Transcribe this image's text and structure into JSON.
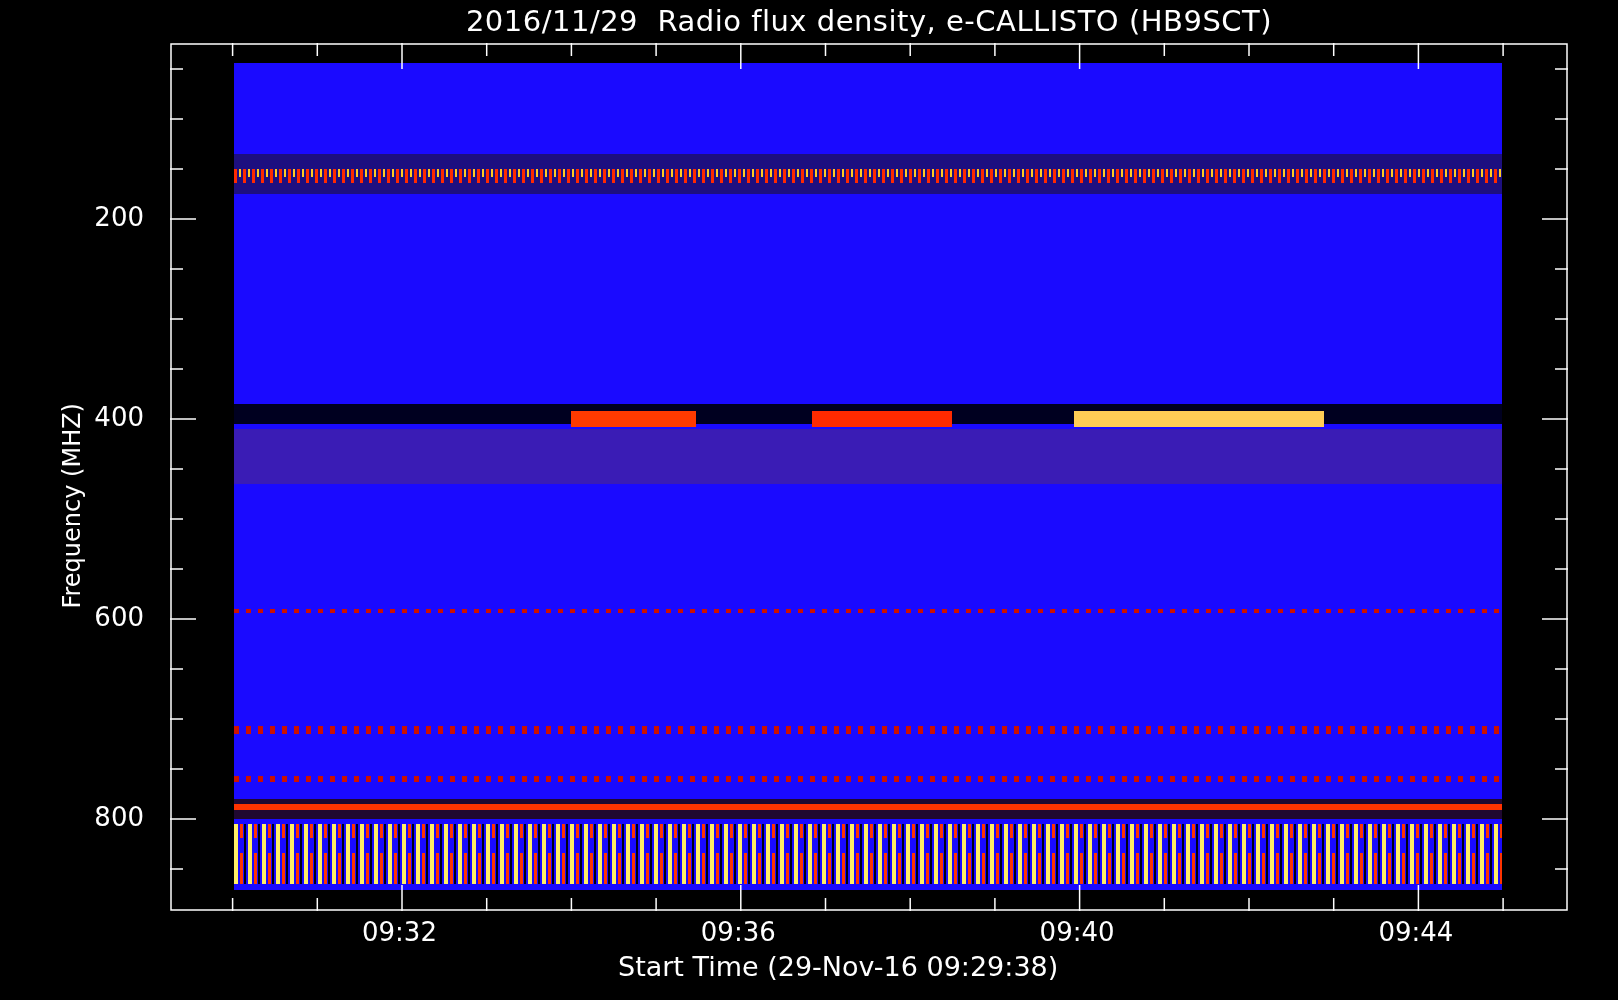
{
  "title": "2016/11/29  Radio flux density, e-CALLISTO (HB9SCT)",
  "y_axis": {
    "label": "Frequency (MHZ)",
    "ticks": [
      "200",
      "400",
      "600",
      "800"
    ]
  },
  "x_axis": {
    "label": "Start Time (29-Nov-16 09:29:38)",
    "ticks": [
      "09:32",
      "09:36",
      "09:40",
      "09:44"
    ]
  }
}
